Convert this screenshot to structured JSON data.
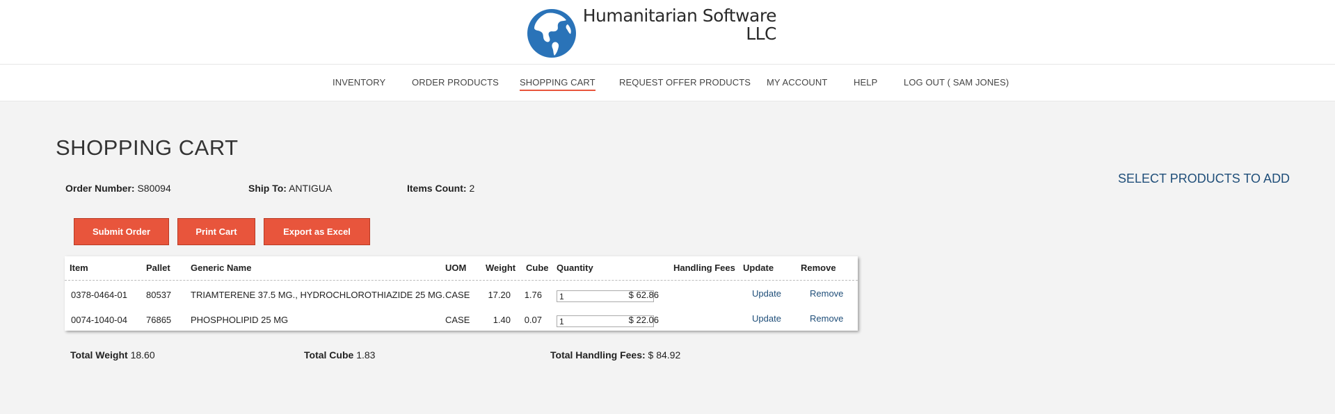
{
  "brand": {
    "name_line1": "Humanitarian Software",
    "name_line2": "LLC",
    "logo_icon": "globe-icon"
  },
  "nav": {
    "items": [
      {
        "label": "INVENTORY",
        "active": false
      },
      {
        "label": "ORDER PRODUCTS",
        "active": false
      },
      {
        "label": "SHOPPING CART",
        "active": true
      },
      {
        "label": "REQUEST OFFER PRODUCTS",
        "active": false
      },
      {
        "label": "MY ACCOUNT",
        "active": false
      },
      {
        "label": "HELP",
        "active": false
      },
      {
        "label": "LOG OUT ( SAM JONES)",
        "active": false
      }
    ]
  },
  "page": {
    "title": "SHOPPING CART",
    "select_products_link": "SELECT PRODUCTS TO ADD"
  },
  "order": {
    "number_label": "Order Number:",
    "number": "S80094",
    "ship_to_label": "Ship To:",
    "ship_to": "ANTIGUA",
    "items_count_label": "Items Count:",
    "items_count": "2"
  },
  "buttons": {
    "submit": "Submit Order",
    "print": "Print Cart",
    "export": "Export as Excel"
  },
  "table": {
    "headers": [
      "Item",
      "Pallet",
      "Generic Name",
      "UOM",
      "Weight",
      "Cube",
      "Quantity",
      "Handling Fees",
      "Update",
      "Remove"
    ],
    "rows": [
      {
        "item": "0378-0464-01",
        "pallet": "80537",
        "generic_name": "TRIAMTERENE 37.5 MG., HYDROCHLOROTHIAZIDE 25 MG.",
        "uom": "CASE",
        "weight": "17.20",
        "cube": "1.76",
        "quantity": "1",
        "handling_fees": "$ 62.86",
        "update": "Update",
        "remove": "Remove"
      },
      {
        "item": "0074-1040-04",
        "pallet": "76865",
        "generic_name": "PHOSPHOLIPID 25 MG",
        "uom": "CASE",
        "weight": "1.40",
        "cube": "0.07",
        "quantity": "1",
        "handling_fees": "$ 22.06",
        "update": "Update",
        "remove": "Remove"
      }
    ]
  },
  "totals": {
    "weight_label": "Total Weight",
    "weight": "18.60",
    "cube_label": "Total Cube",
    "cube": "1.83",
    "fees_label": "Total Handling Fees:",
    "fees": "$ 84.92"
  },
  "colors": {
    "accent": "#e8553c",
    "link": "#1f4e79",
    "globe": "#2a73b8"
  }
}
